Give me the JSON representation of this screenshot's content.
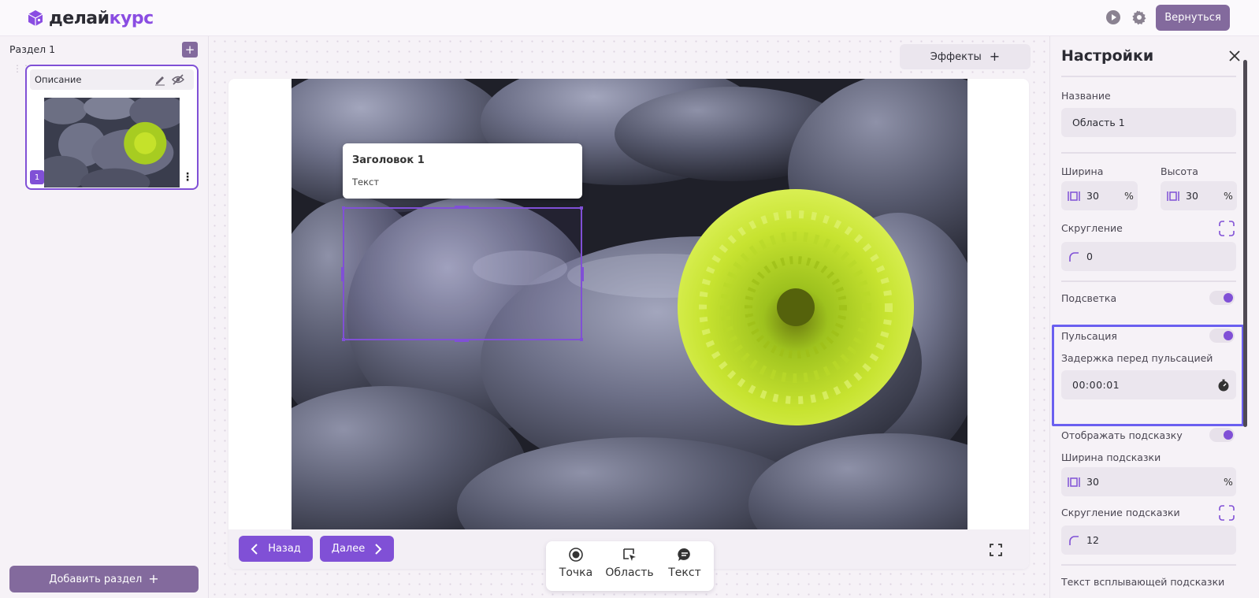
{
  "topbar": {
    "logo_part1": "делай",
    "logo_part2": "курс",
    "play_icon": "play-icon",
    "settings_icon": "gear-icon",
    "return_label": "Вернуться"
  },
  "left": {
    "section_title": "Раздел 1",
    "slide": {
      "name": "Описание",
      "number": "1"
    },
    "add_section_label": "Добавить раздел"
  },
  "canvas": {
    "effects_label": "Эффекты",
    "popup": {
      "title": "Заголовок 1",
      "text": "Текст"
    },
    "back_label": "Назад",
    "next_label": "Далее",
    "tools": [
      {
        "label": "Точка",
        "icon": "point-icon"
      },
      {
        "label": "Область",
        "icon": "area-icon"
      },
      {
        "label": "Текст",
        "icon": "text-bubble-icon"
      }
    ]
  },
  "settings": {
    "title": "Настройки",
    "name_label": "Название",
    "name_value": "Область 1",
    "width_label": "Ширина",
    "width_value": "30",
    "height_label": "Высота",
    "height_value": "30",
    "unit": "%",
    "rounding_label": "Скругление",
    "rounding_value": "0",
    "highlight_label": "Подсветка",
    "pulse_label": "Пульсация",
    "pulse_delay_label": "Задержка перед пульсацией",
    "pulse_delay_value": "00:00:01",
    "show_hint_label": "Отображать подсказку",
    "hint_width_label": "Ширина подсказки",
    "hint_width_value": "30",
    "hint_rounding_label": "Скругление подсказки",
    "hint_rounding_value": "12",
    "popup_text_label": "Текст всплывающей подсказки"
  },
  "colors": {
    "accent": "#8050d6",
    "muted_button": "#836a9d",
    "focus_outline": "#6a5ff0"
  }
}
